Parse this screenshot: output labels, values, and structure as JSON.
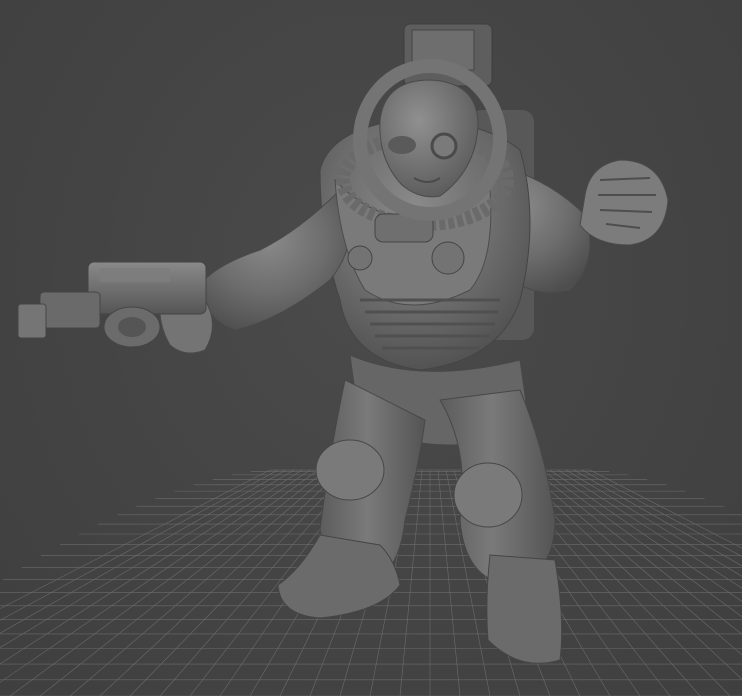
{
  "viewport": {
    "background_color": "#444444",
    "grid_color": "#8c8c8c",
    "model_color": "#6b6b6b",
    "model_shadow_color": "#4a4a4a",
    "model_highlight_color": "#8e8e8e"
  },
  "scene": {
    "model_icon": "alien-astronaut-miniature-with-pistol",
    "grid_icon": "ground-plane-grid"
  }
}
